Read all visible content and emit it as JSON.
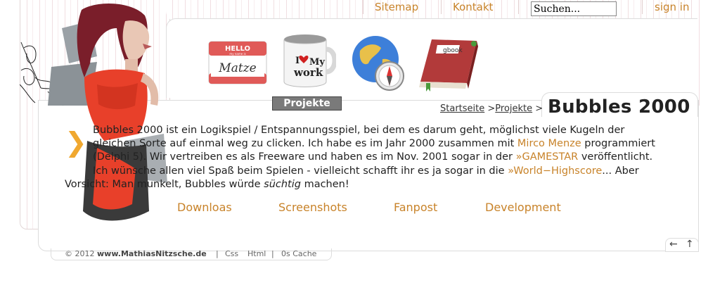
{
  "topnav": {
    "sitemap": "Sitemap",
    "kontakt": "Kontakt",
    "search_value": "Suchen...",
    "signin": "sign in"
  },
  "icons": {
    "hello_top": "HELLO",
    "hello_sub": "my name is",
    "hello_name": "Matze",
    "mug_line1": "I",
    "mug_line2": "My",
    "mug_line3": "work",
    "gbook": "gbook",
    "active_label": "Projekte"
  },
  "breadcrumb": {
    "home": "Startseite",
    "sep1": " >",
    "projects": "Projekte",
    "sep2": " >"
  },
  "title": "Bubbles 2000",
  "body": {
    "l1": "Bubbles 2000 ist ein Logikspiel / Entspannungsspiel, bei dem es darum geht, möglichst viele Kugeln der",
    "l2": "gleichen Sorte auf einmal weg zu clicken. Ich habe es im Jahr 2000 zusammen mit ",
    "l2_link": "Mirco Menze",
    "l2_end": " programmiert",
    "l3": "(Delphi 5). Wir vertreiben es als Freeware und haben es im Nov. 2001 sogar in der ",
    "l3_link": "»GAMESTAR",
    "l3_end": " veröffentlicht.",
    "l4": "Ich wünsche allen viel Spaß beim Spielen - vielleicht schafft ihr es ja sogar in die ",
    "l4_link": "»World−Highscore",
    "l4_end": "... Aber",
    "l5": "Vorsicht: Man munkelt, Bubbles würde ",
    "l5_em": "süchtig",
    "l5_end": " machen!"
  },
  "sublinks": [
    "Downloas",
    "Screenshots",
    "Fanpost",
    "Development"
  ],
  "arrows": {
    "back": "←",
    "up": "↑"
  },
  "footer": {
    "copy": "© 2012 ",
    "site": "www.MathiasNitzsche.de",
    "sep": "|",
    "css": "Css",
    "html": "Html",
    "cache": "0s Cache"
  },
  "colors": {
    "accent": "#c8832a",
    "chevron": "#f0a830",
    "shirt": "#e8402a",
    "hair": "#7a1e2a"
  }
}
